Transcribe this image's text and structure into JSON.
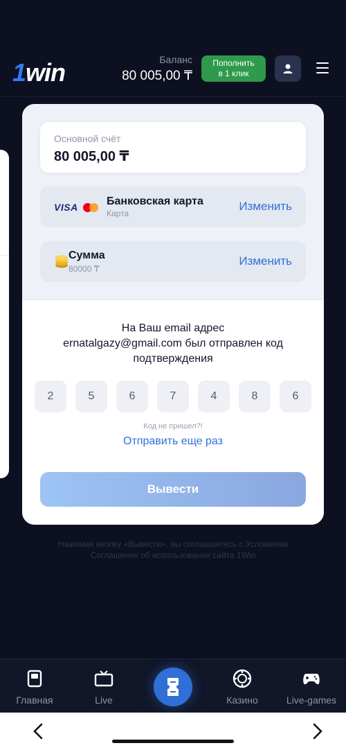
{
  "header": {
    "logo": "1win",
    "balance_label": "Баланс",
    "balance_value": "80 005,00 ₸",
    "topup_label_line1": "Пополнить",
    "topup_label_line2": "в 1 клик",
    "accent_color": "#2f7bf5",
    "topup_color": "#2f9a4c"
  },
  "account": {
    "label": "Основной счёт",
    "value": "80 005,00 ₸"
  },
  "payment_method": {
    "brand_text": "VISA",
    "title": "Банковская карта",
    "subtitle": "Карта",
    "action": "Изменить"
  },
  "amount": {
    "title": "Сумма",
    "subtitle": "80000 ₸",
    "action": "Изменить"
  },
  "confirmation": {
    "message_line1": "На Ваш email адрес",
    "message_line2": "ernatalgazy@gmail.com был отправлен код",
    "message_line3": "подтверждения",
    "code_digits": [
      "2",
      "5",
      "6",
      "7",
      "4",
      "8",
      "6"
    ],
    "no_code_text": "Код не пришел?!",
    "resend_label": "Отправить еще раз",
    "submit_label": "Вывести"
  },
  "terms": {
    "line1": "Нажимая кнопку «Вывести», вы соглашаетесь с Условиями",
    "line2": "Соглашения об использовании сайта 1Win"
  },
  "bottom_nav": {
    "items": [
      {
        "label": "Главная",
        "icon": "home-icon"
      },
      {
        "label": "Live",
        "icon": "tv-icon"
      },
      {
        "label": "",
        "icon": "coupon-icon"
      },
      {
        "label": "Казино",
        "icon": "casino-chip-icon"
      },
      {
        "label": "Live-games",
        "icon": "gamepad-icon"
      }
    ]
  },
  "browser": {
    "back_icon": "chevron-left-icon",
    "forward_icon": "chevron-right-icon"
  }
}
